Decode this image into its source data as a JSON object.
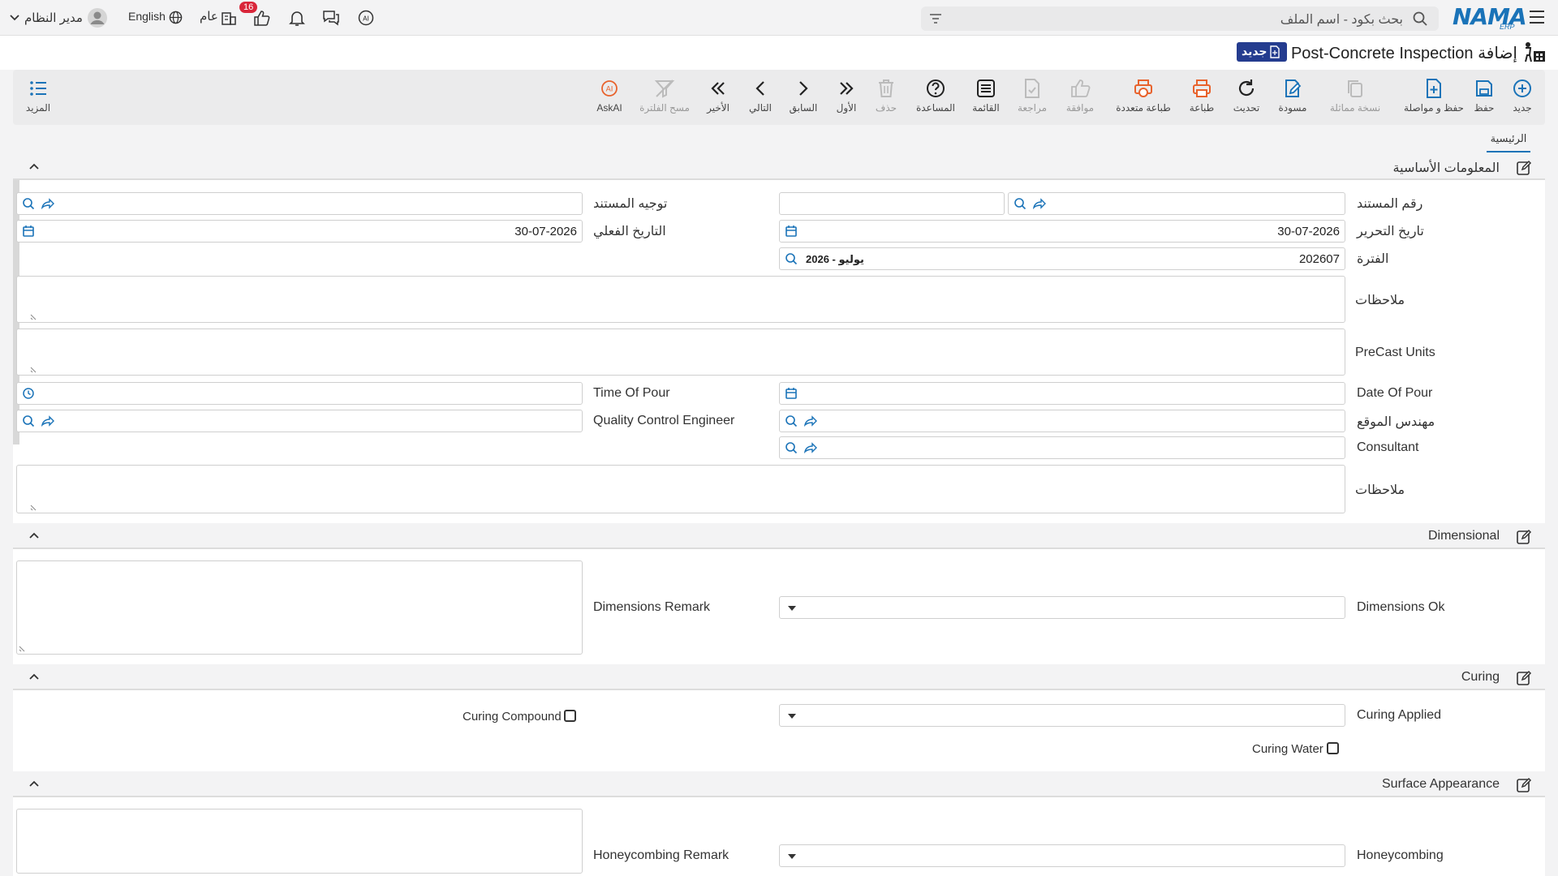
{
  "app": {
    "logo_text": "NAMA",
    "logo_sub": "ERP",
    "search_placeholder": "بحث بكود - اسم الملف",
    "user": "مدير النظام",
    "language": "English",
    "public_label": "عام",
    "badge_count": "16"
  },
  "page": {
    "title": "إضافة Post-Concrete Inspection",
    "new_badge": "جديد"
  },
  "toolbar": {
    "new": "جديد",
    "save": "حفظ",
    "save_continue": "حفظ و مواصلة",
    "copy": "نسخة مماثلة",
    "draft": "مسودة",
    "refresh": "تحديث",
    "print": "طباعة",
    "multi_print": "طباعة متعددة",
    "approve": "موافقة",
    "review": "مراجعة",
    "list": "القائمة",
    "help": "المساعدة",
    "delete": "حذف",
    "first": "الأول",
    "prev": "السابق",
    "next": "التالي",
    "last": "الأخير",
    "clear_filter": "مسح الفلترة",
    "askai": "AskAI",
    "more": "المزيد"
  },
  "tabs": {
    "main": "الرئيسية"
  },
  "sections": {
    "basic": "المعلومات الأساسية",
    "dimensional": "Dimensional",
    "curing": "Curing",
    "surface": "Surface Appearance"
  },
  "fields": {
    "doc_no": {
      "label": "رقم المستند"
    },
    "doc_direction": {
      "label": "توجيه المستند"
    },
    "edit_date": {
      "label": "تاريخ التحرير",
      "value": "30-07-2026"
    },
    "actual_date": {
      "label": "التاريخ الفعلي",
      "value": "30-07-2026"
    },
    "period": {
      "label": "الفترة",
      "value": "202607",
      "name": "2026 - يوليو"
    },
    "notes1": {
      "label": "ملاحظات"
    },
    "precast_units": {
      "label": "PreCast Units"
    },
    "date_of_pour": {
      "label": "Date Of Pour"
    },
    "time_of_pour": {
      "label": "Time Of Pour"
    },
    "site_engineer": {
      "label": "مهندس الموقع"
    },
    "qc_engineer": {
      "label": "Quality Control Engineer"
    },
    "consultant": {
      "label": "Consultant"
    },
    "notes2": {
      "label": "ملاحظات"
    },
    "dimensions_ok": {
      "label": "Dimensions Ok"
    },
    "dimensions_remark": {
      "label": "Dimensions Remark"
    },
    "curing_applied": {
      "label": "Curing Applied"
    },
    "curing_compound": {
      "label": "Curing Compound"
    },
    "curing_water": {
      "label": "Curing Water"
    },
    "honeycombing": {
      "label": "Honeycombing"
    },
    "honeycombing_remark": {
      "label": "Honeycombing Remark"
    }
  },
  "colors": {
    "accent": "#1a73b8",
    "orange": "#e8622c",
    "badge_red": "#d9263a",
    "navy": "#243c8f"
  }
}
